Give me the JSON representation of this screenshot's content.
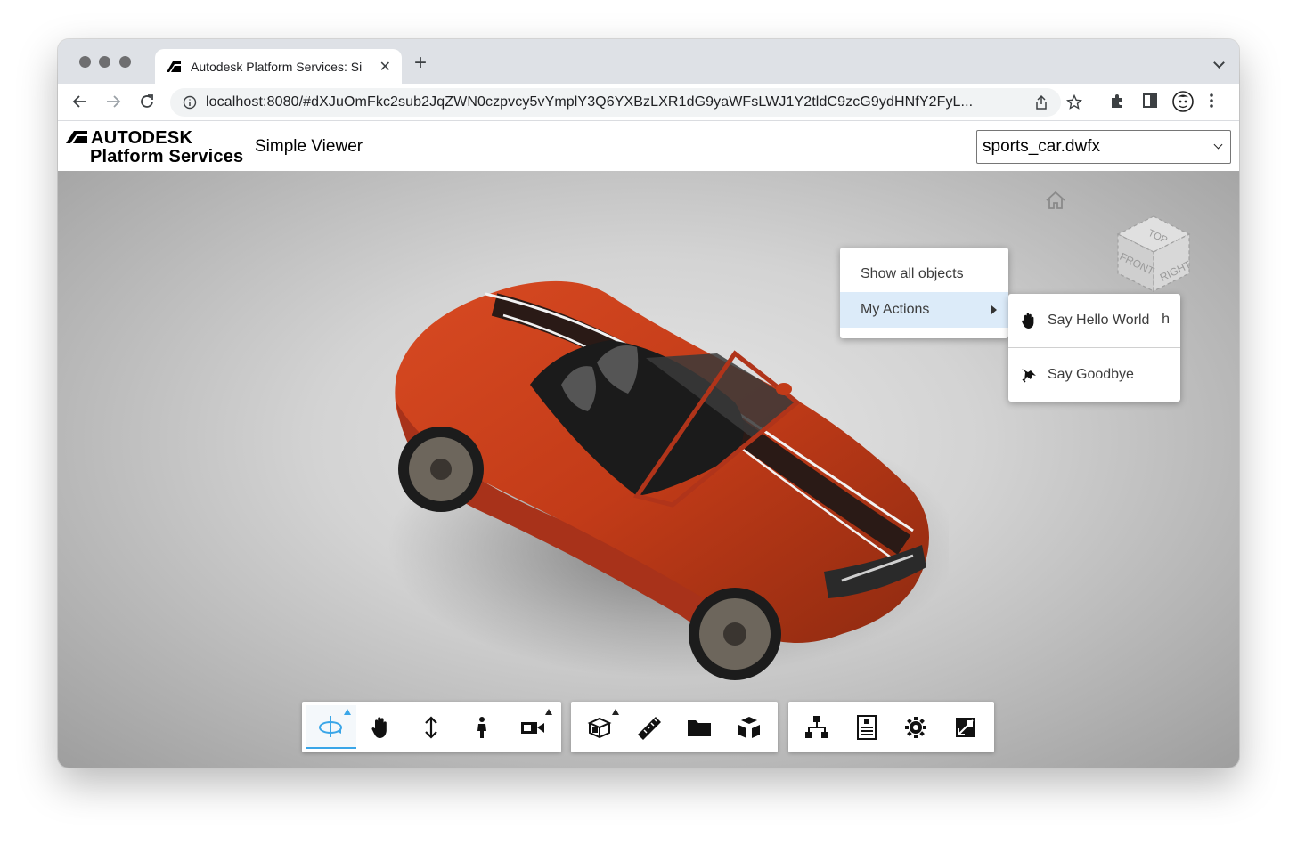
{
  "browser": {
    "tab": {
      "title": "Autodesk Platform Services: Si"
    },
    "url": "localhost:8080/#dXJuOmFkc2sub2JqZWN0czpvcy5vYmplY3Q6YXBzLXR1dG9yaWFsLWJ1Y2tldC9zcG9ydHNfY2FyL..."
  },
  "app": {
    "brand_line1": "AUTODESK",
    "brand_line2": "Platform Services",
    "title": "Simple Viewer",
    "model_select": {
      "selected": "sports_car.dwfx"
    }
  },
  "viewcube": {
    "top": "TOP",
    "front": "FRONT",
    "right": "RIGHT"
  },
  "context_menu": {
    "items": [
      {
        "label": "Show all objects"
      },
      {
        "label": "My Actions"
      }
    ],
    "submenu": [
      {
        "label": "Say Hello World",
        "shortcut": "h",
        "icon": "hand-icon"
      },
      {
        "label": "Say Goodbye",
        "icon": "wave-icon"
      }
    ]
  },
  "toolbar_groups": [
    [
      "orbit-icon",
      "pan-icon",
      "zoom-icon",
      "first-person-icon",
      "camera-icon"
    ],
    [
      "section-icon",
      "measure-icon",
      "model-browser-icon",
      "explode-icon"
    ],
    [
      "structure-icon",
      "properties-icon",
      "settings-icon",
      "fullscreen-icon"
    ]
  ],
  "colors": {
    "car": "#c0391b",
    "accent": "#3aa6e8",
    "menu_highlight": "#dcebf9"
  }
}
